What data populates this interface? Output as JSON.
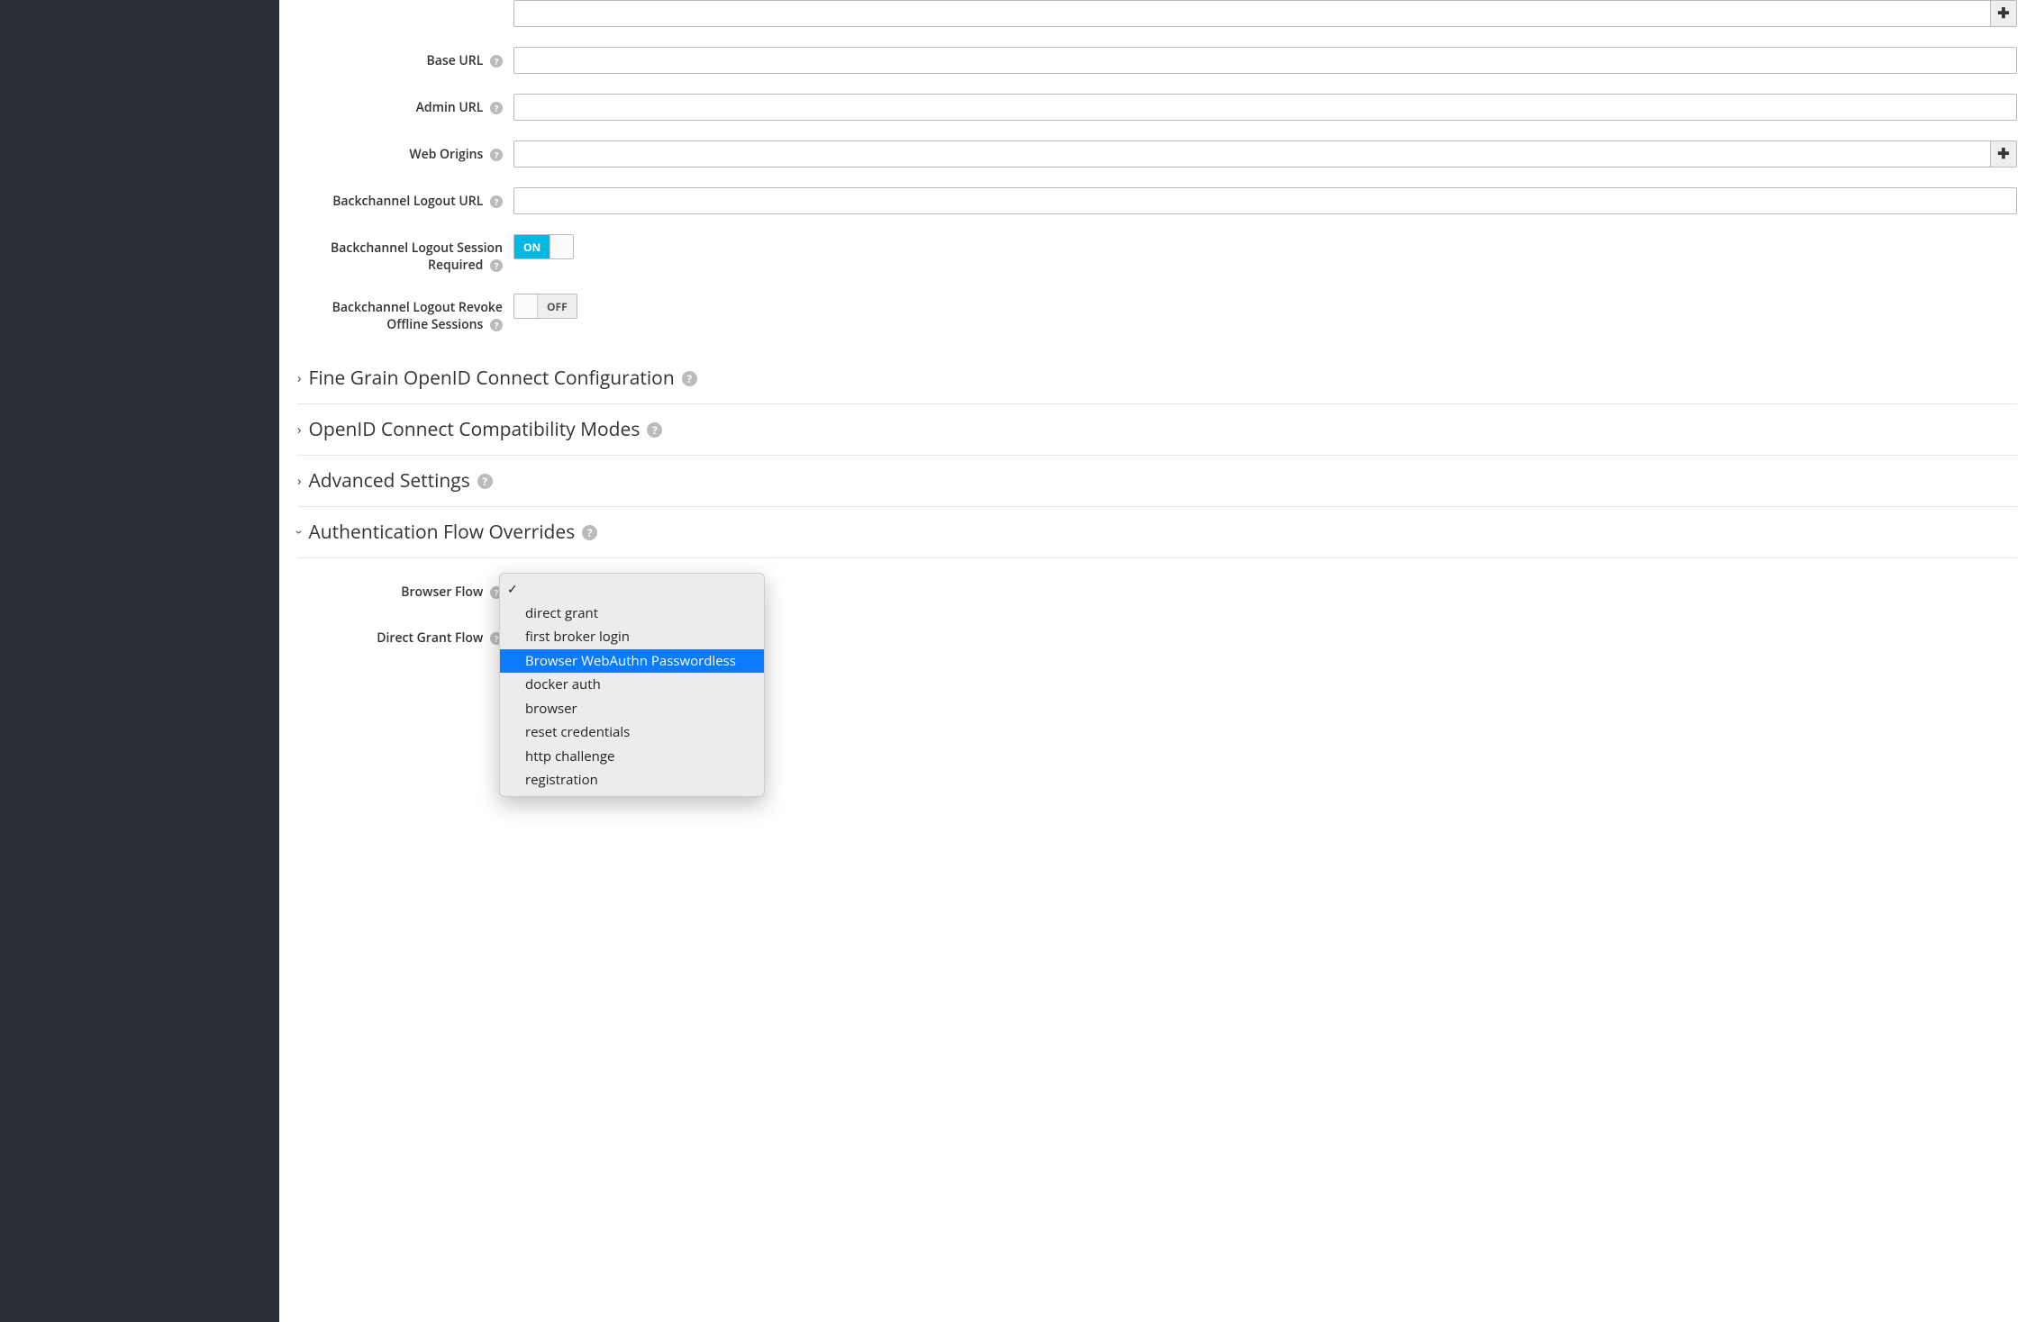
{
  "fields": {
    "baseUrl": {
      "label": "Base URL",
      "value": ""
    },
    "adminUrl": {
      "label": "Admin URL",
      "value": ""
    },
    "webOrigins": {
      "label": "Web Origins",
      "value": ""
    },
    "backchannelLogoutUrl": {
      "label": "Backchannel Logout URL",
      "value": ""
    },
    "backchannelLogoutSessionRequired": {
      "label": "Backchannel Logout Session Required"
    },
    "backchannelLogoutRevokeOfflineSessions": {
      "label": "Backchannel Logout Revoke Offline Sessions"
    },
    "browserFlow": {
      "label": "Browser Flow"
    },
    "directGrantFlow": {
      "label": "Direct Grant Flow"
    }
  },
  "switches": {
    "on": "ON",
    "off": "OFF"
  },
  "sections": {
    "fineGrain": "Fine Grain OpenID Connect Configuration",
    "compatModes": "OpenID Connect Compatibility Modes",
    "advanced": "Advanced Settings",
    "authFlowOverrides": "Authentication Flow Overrides"
  },
  "dropdown": {
    "selected": "",
    "options": [
      "",
      "direct grant",
      "first broker login",
      "Browser WebAuthn Passwordless",
      "docker auth",
      "browser",
      "reset credentials",
      "http challenge",
      "registration"
    ],
    "highlightedIndex": 3
  }
}
